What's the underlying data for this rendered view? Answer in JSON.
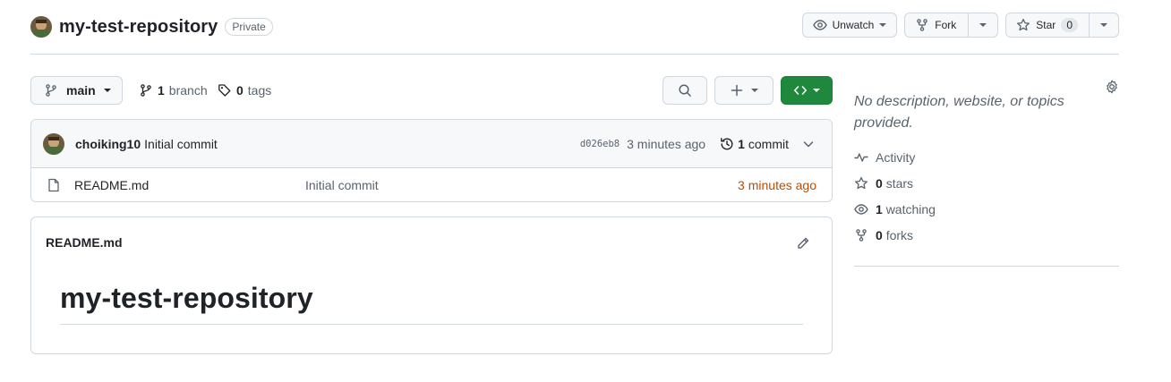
{
  "repo": {
    "name": "my-test-repository",
    "visibility": "Private"
  },
  "header_actions": {
    "watch_label": "Unwatch",
    "fork_label": "Fork",
    "star_label": "Star",
    "star_count": "0"
  },
  "file_nav": {
    "branch": "main",
    "branch_count": "1",
    "branch_word": "branch",
    "tag_count": "0",
    "tag_word": "tags"
  },
  "latest_commit": {
    "author": "choiking10",
    "message": "Initial commit",
    "sha": "d026eb8",
    "time": "3 minutes ago",
    "commit_count": "1",
    "commit_word": "commit"
  },
  "files": [
    {
      "name": "README.md",
      "commit_message": "Initial commit",
      "age": "3 minutes ago"
    }
  ],
  "readme": {
    "filename": "README.md",
    "heading": "my-test-repository"
  },
  "about": {
    "description": "No description, website, or topics provided.",
    "activity_label": "Activity",
    "stars_count": "0",
    "stars_word": "stars",
    "watching_count": "1",
    "watching_word": "watching",
    "forks_count": "0",
    "forks_word": "forks"
  },
  "colors": {
    "primary_button": "#1f883d",
    "file_age": "#bc4c00",
    "muted_text": "#59636e",
    "border": "#d1d9e0"
  },
  "icons": [
    "avatar",
    "eye-icon",
    "repo-forked-icon",
    "star-icon",
    "git-branch-icon",
    "tag-icon",
    "search-icon",
    "plus-icon",
    "code-icon",
    "history-icon",
    "chevron-down-icon",
    "file-icon",
    "pencil-icon",
    "gear-icon",
    "pulse-icon"
  ]
}
